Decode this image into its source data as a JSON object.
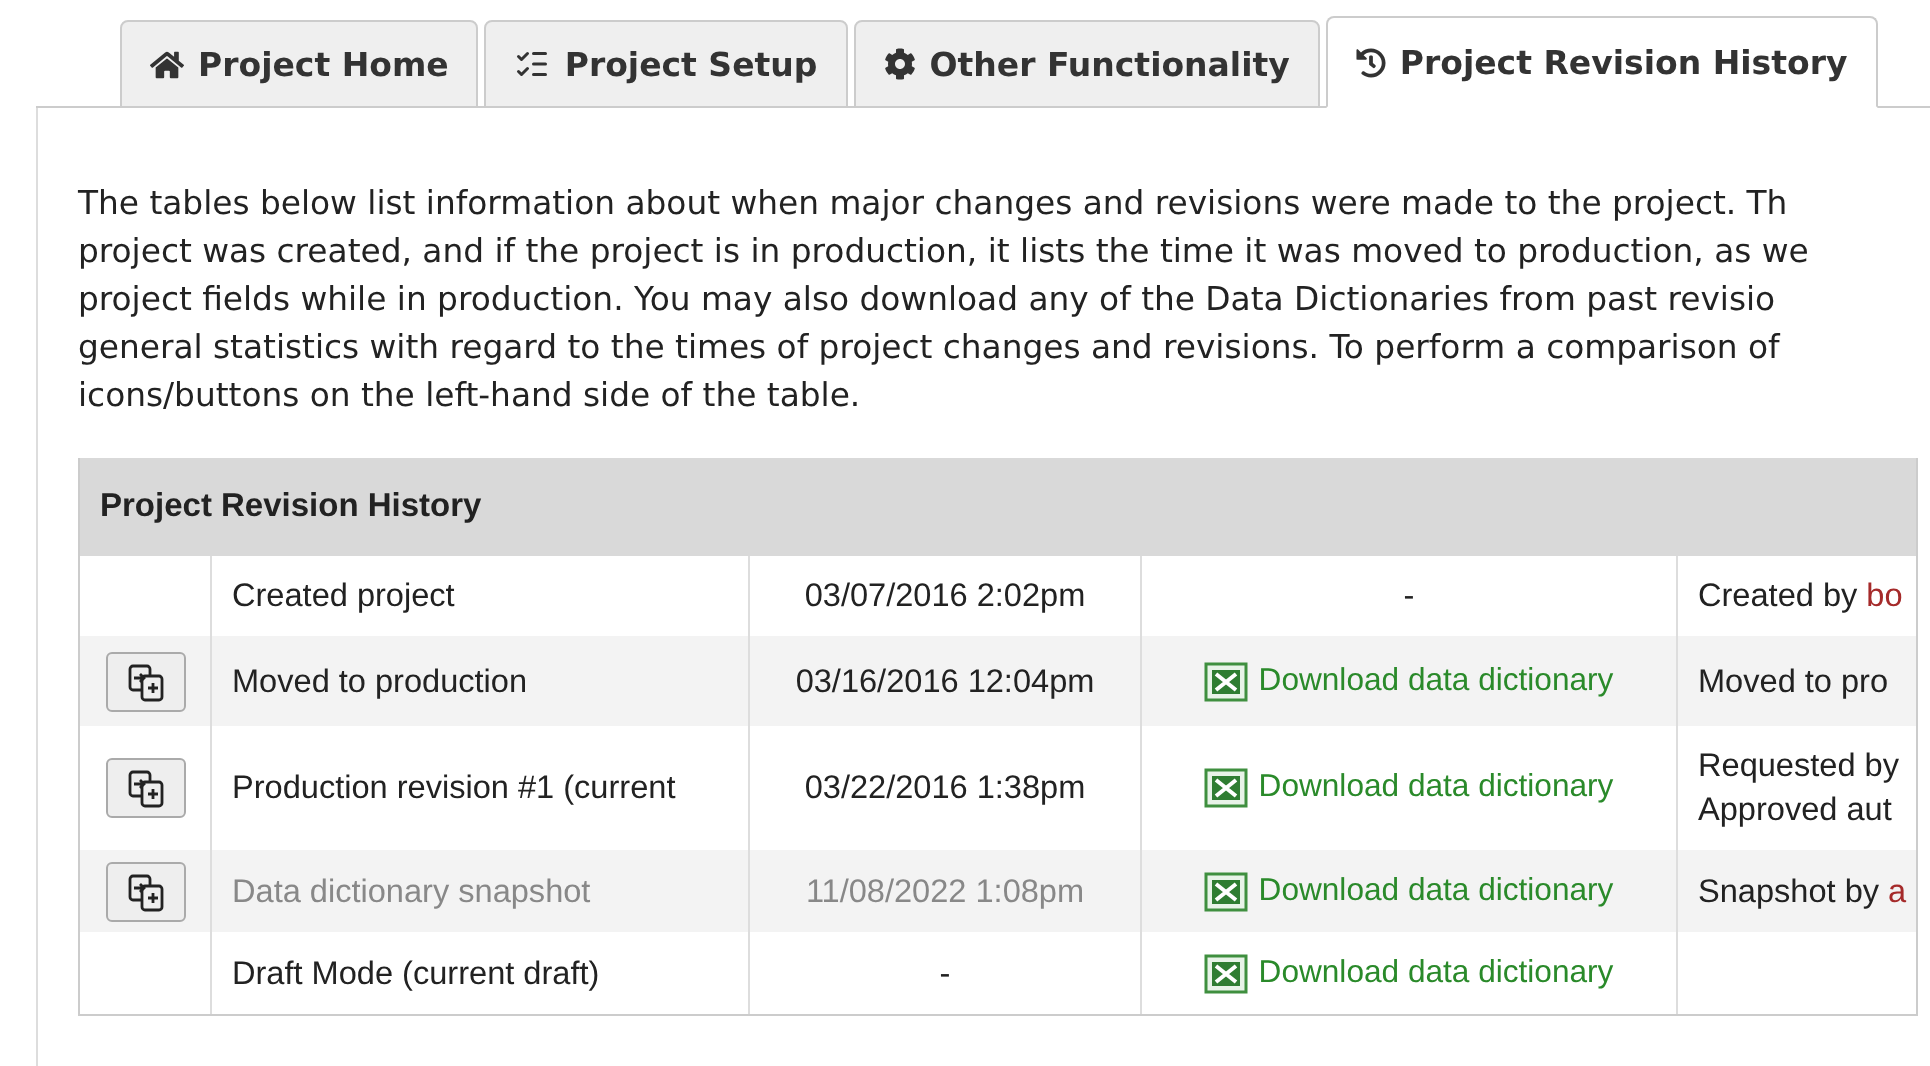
{
  "tabs": [
    {
      "label": "Project Home",
      "kind": "home",
      "selected": false
    },
    {
      "label": "Project Setup",
      "kind": "setup",
      "selected": false
    },
    {
      "label": "Other Functionality",
      "kind": "functions",
      "selected": false
    },
    {
      "label": "Project Revision History",
      "kind": "history",
      "selected": true
    }
  ],
  "intro_lines": [
    "The tables below list information about when major changes and revisions were made to the project. Th",
    "project was created, and if the project is in production, it lists the time it was moved to production, as we",
    "project fields while in production. You may also download any of the Data Dictionaries from past revisio",
    "general statistics with regard to the times of project changes and revisions. To perform a comparison of",
    "icons/buttons on the left-hand side of the table."
  ],
  "table": {
    "title": "Project Revision History",
    "rows": [
      {
        "compare": false,
        "muted": false,
        "event": "Created project",
        "time": "03/07/2016 2:02pm",
        "download": "-",
        "details": [
          {
            "text": "Created by ",
            "user": "bo"
          }
        ]
      },
      {
        "compare": true,
        "muted": false,
        "event": "Moved to production",
        "time": "03/16/2016 12:04pm",
        "download": "Download data dictionary",
        "details": [
          {
            "text": "Moved to pro"
          }
        ]
      },
      {
        "compare": true,
        "muted": false,
        "event": "Production revision #1 (current",
        "time": "03/22/2016 1:38pm",
        "download": "Download data dictionary",
        "details": [
          {
            "text": "Requested by"
          },
          {
            "text": "Approved aut"
          }
        ]
      },
      {
        "compare": true,
        "muted": true,
        "event": "Data dictionary snapshot",
        "time": "11/08/2022 1:08pm",
        "download": "Download data dictionary",
        "details": [
          {
            "text": "Snapshot by ",
            "user": "a"
          }
        ]
      },
      {
        "compare": false,
        "muted": false,
        "event": "Draft Mode (current draft)",
        "time": "-",
        "download": "Download data dictionary",
        "details": []
      }
    ]
  }
}
